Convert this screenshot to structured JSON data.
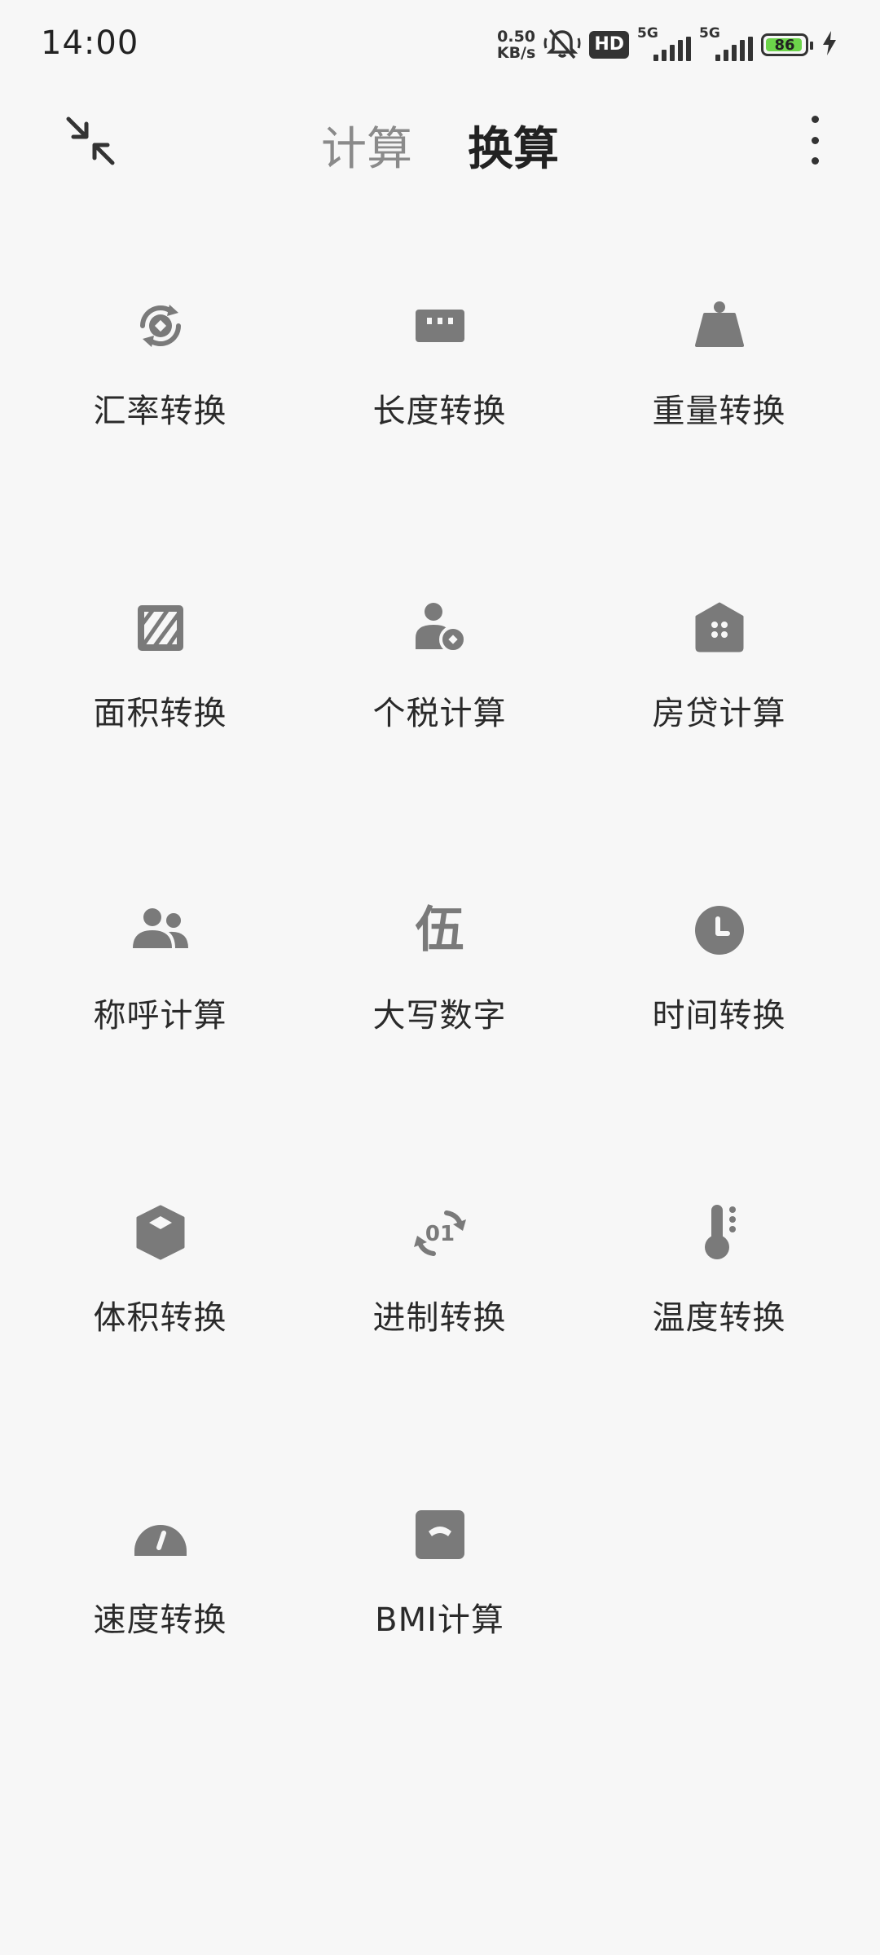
{
  "status_bar": {
    "time": "14:00",
    "net_speed_value": "0.50",
    "net_speed_unit": "KB/s",
    "hd_badge": "HD",
    "sim1_tag": "5G",
    "sim2_tag": "5G",
    "battery_level": "86",
    "colors": {
      "battery_fill": "#6cd44a"
    }
  },
  "toolbar": {
    "tabs": [
      {
        "label": "计算",
        "active": false
      },
      {
        "label": "换算",
        "active": true
      }
    ]
  },
  "converters": [
    {
      "label": "汇率转换",
      "icon": "currency-exchange-icon"
    },
    {
      "label": "长度转换",
      "icon": "ruler-icon"
    },
    {
      "label": "重量转换",
      "icon": "weight-icon"
    },
    {
      "label": "面积转换",
      "icon": "area-icon"
    },
    {
      "label": "个税计算",
      "icon": "person-tax-icon"
    },
    {
      "label": "房贷计算",
      "icon": "house-icon"
    },
    {
      "label": "称呼计算",
      "icon": "people-icon"
    },
    {
      "label": "大写数字",
      "icon": "uppercase-number-icon",
      "glyph": "伍"
    },
    {
      "label": "时间转换",
      "icon": "clock-icon"
    },
    {
      "label": "体积转换",
      "icon": "cube-icon"
    },
    {
      "label": "进制转换",
      "icon": "number-base-icon"
    },
    {
      "label": "温度转换",
      "icon": "thermometer-icon"
    },
    {
      "label": "速度转换",
      "icon": "speedometer-icon"
    },
    {
      "label": "BMI计算",
      "icon": "bmi-scale-icon"
    }
  ]
}
